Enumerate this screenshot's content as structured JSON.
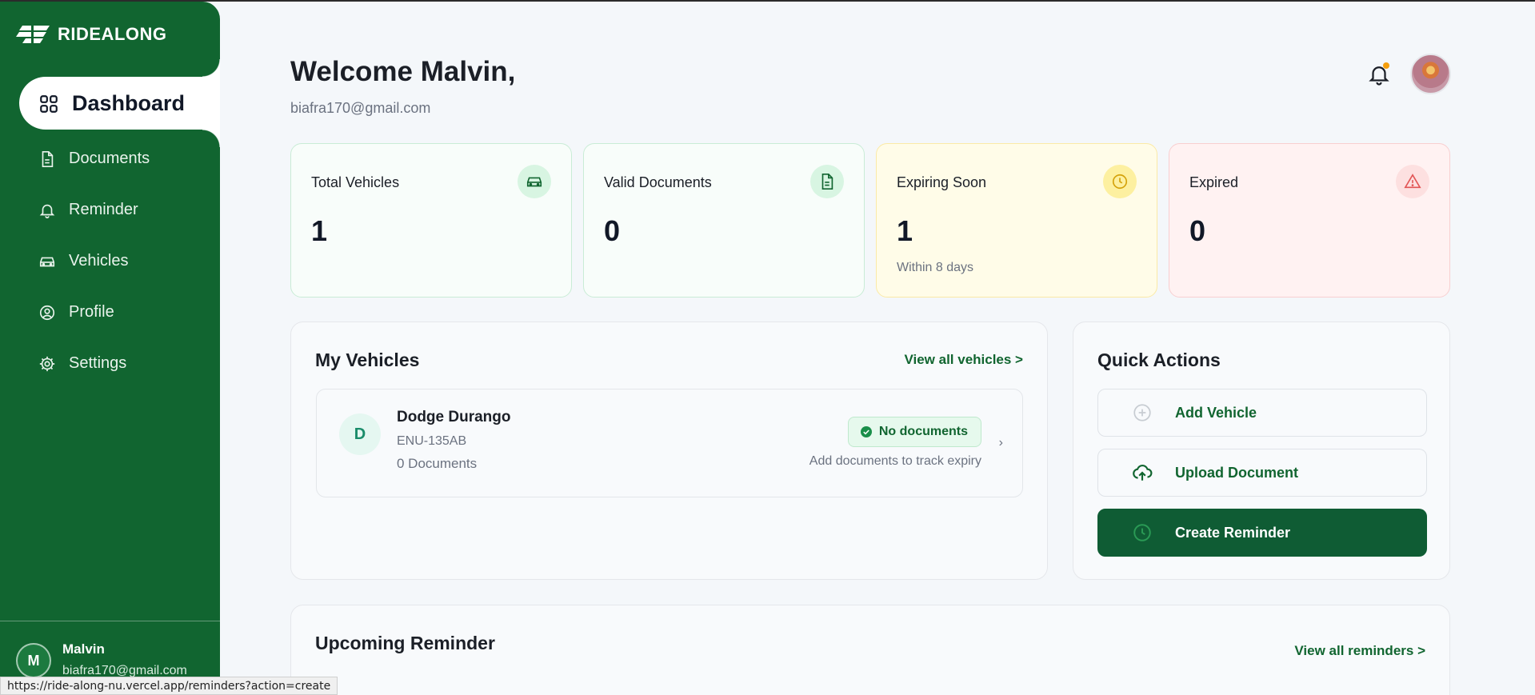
{
  "app": {
    "logo_text": "RIDEALONG"
  },
  "sidebar": {
    "items": [
      {
        "label": "Dashboard",
        "icon": "grid-icon",
        "active": true
      },
      {
        "label": "Documents",
        "icon": "document-icon"
      },
      {
        "label": "Reminder",
        "icon": "bell-icon"
      },
      {
        "label": "Vehicles",
        "icon": "car-icon"
      },
      {
        "label": "Profile",
        "icon": "user-circle-icon"
      },
      {
        "label": "Settings",
        "icon": "gear-icon"
      }
    ],
    "user": {
      "initial": "M",
      "name": "Malvin",
      "email": "biafra170@gmail.com"
    }
  },
  "header": {
    "welcome": "Welcome Malvin,",
    "email": "biafra170@gmail.com"
  },
  "stats": [
    {
      "label": "Total Vehicles",
      "value": "1",
      "sub": "",
      "icon": "car-icon",
      "accent": "#116530"
    },
    {
      "label": "Valid Documents",
      "value": "0",
      "sub": "",
      "icon": "document-icon",
      "accent": "#116530"
    },
    {
      "label": "Expiring Soon",
      "value": "1",
      "sub": "Within 8 days",
      "icon": "clock-icon",
      "accent": "#d4a20a"
    },
    {
      "label": "Expired",
      "value": "0",
      "sub": "",
      "icon": "alert-triangle-icon",
      "accent": "#e25555"
    }
  ],
  "vehicles": {
    "title": "My Vehicles",
    "view_all": "View all vehicles >",
    "items": [
      {
        "initial": "D",
        "name": "Dodge Durango",
        "plate": "ENU-135AB",
        "docs": "0 Documents",
        "badge": "No documents",
        "badge_sub": "Add documents to track expiry"
      }
    ]
  },
  "quick_actions": {
    "title": "Quick Actions",
    "items": [
      {
        "label": "Add Vehicle",
        "icon": "plus-circle-icon"
      },
      {
        "label": "Upload Document",
        "icon": "cloud-upload-icon"
      },
      {
        "label": "Create Reminder",
        "icon": "clock-icon"
      }
    ]
  },
  "reminders": {
    "title": "Upcoming Reminder",
    "view_all": "View all reminders >"
  },
  "status_url": "https://ride-along-nu.vercel.app/reminders?action=create",
  "colors": {
    "brand": "#116530",
    "brand_dark": "#0f5c34",
    "background": "#f4f7fa"
  }
}
